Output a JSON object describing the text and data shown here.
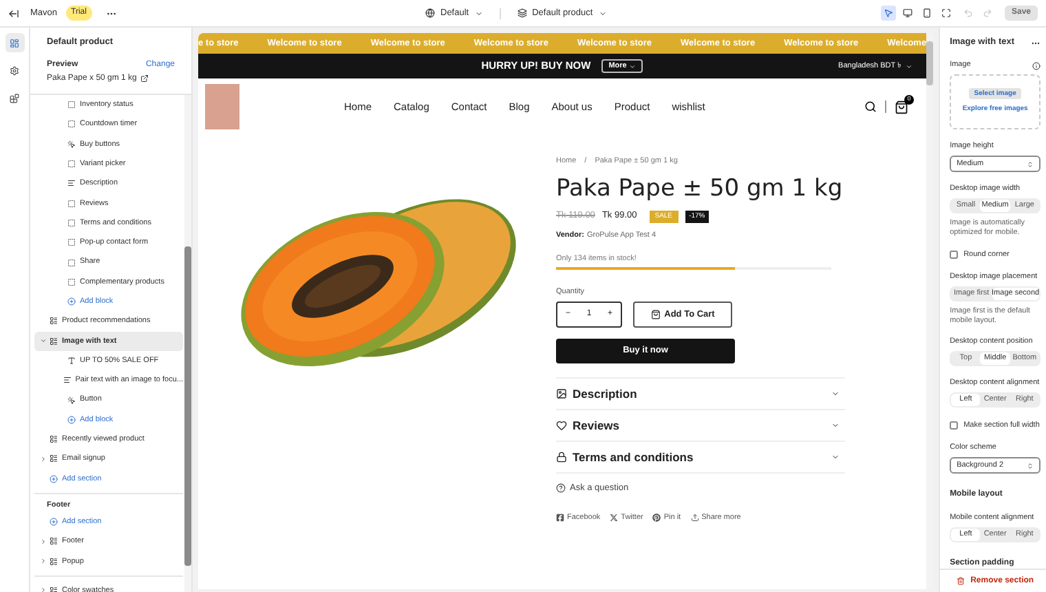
{
  "top_bar": {
    "store": "Mavon",
    "badge": "Trial",
    "theme_menu": "Default",
    "template_menu": "Default product",
    "save": {
      "label": "Save",
      "disabled": true
    },
    "tools": [
      {
        "kind": "inspect",
        "selected": true
      },
      {
        "kind": "desktop",
        "selected": false
      },
      {
        "kind": "mobile",
        "selected": false
      },
      {
        "kind": "fullscreen",
        "selected": false
      }
    ]
  },
  "rail": [
    {
      "kind": "sections",
      "selected": true
    },
    {
      "kind": "settings",
      "selected": false
    },
    {
      "kind": "apps",
      "selected": false
    }
  ],
  "left_panel": {
    "title": "Default product",
    "preview": {
      "label": "Preview",
      "action": "Change",
      "value": "Paka Pape x 50 gm 1 kg"
    },
    "groups": [
      {
        "items": [
          {
            "kind": "blocks",
            "children": [
              {
                "kind": "block",
                "label": "Inventory status",
                "selected": false
              },
              {
                "kind": "block",
                "label": "Countdown timer",
                "selected": false
              },
              {
                "kind": "button",
                "label": "Buy buttons",
                "selected": false
              },
              {
                "kind": "block",
                "label": "Variant picker",
                "selected": false
              },
              {
                "kind": "paragraph",
                "label": "Description",
                "selected": false
              },
              {
                "kind": "block",
                "label": "Reviews",
                "selected": false
              },
              {
                "kind": "block",
                "label": "Terms and conditions",
                "selected": false
              },
              {
                "kind": "block",
                "label": "Pop-up contact form",
                "selected": false
              },
              {
                "kind": "block",
                "label": "Share",
                "selected": false
              },
              {
                "kind": "block",
                "label": "Complementary products",
                "selected": false
              },
              {
                "kind": "add",
                "label": "Add block"
              }
            ]
          },
          {
            "kind": "section",
            "label": "Product recommendations",
            "selected": false
          },
          {
            "kind": "section",
            "label": "Image with text",
            "selected": true,
            "expanded": true,
            "children": [
              {
                "kind": "text",
                "label": "UP TO 50% SALE OFF",
                "selected": false
              },
              {
                "kind": "paragraph",
                "label": "Pair text with an image to focu...",
                "selected": false
              },
              {
                "kind": "button",
                "label": "Button",
                "selected": false
              },
              {
                "kind": "add",
                "label": "Add block"
              }
            ]
          },
          {
            "kind": "section",
            "label": "Recently viewed product",
            "selected": false
          },
          {
            "kind": "section",
            "label": "Email signup",
            "selected": false,
            "expanded": false
          },
          {
            "kind": "add",
            "label": "Add section"
          }
        ]
      },
      {
        "title": "Footer",
        "items": [
          {
            "kind": "add",
            "label": "Add section"
          },
          {
            "kind": "section",
            "label": "Footer",
            "selected": false,
            "expanded": false
          },
          {
            "kind": "section",
            "label": "Popup",
            "selected": false,
            "expanded": false
          }
        ]
      },
      {
        "items": [
          {
            "kind": "section",
            "label": "Color swatches",
            "selected": false,
            "expanded": false
          }
        ]
      }
    ]
  },
  "storefront": {
    "announcements": [
      "e to store",
      "Welcome to store",
      "Welcome to store",
      "Welcome to store",
      "Welcome to store",
      "Welcome to store",
      "Welcome to store",
      "Welcome"
    ],
    "promo": {
      "text": "HURRY UP! BUY NOW",
      "button": "More",
      "currency": "Bangladesh BDT ৳"
    },
    "nav": [
      "Home",
      "Catalog",
      "Contact",
      "Blog",
      "About us",
      "Product",
      "wishlist"
    ],
    "cart_count": "0",
    "product": {
      "breadcrumb": [
        "Home",
        "Paka Pape ± 50 gm 1 kg"
      ],
      "breadcrumb_separator": "/",
      "title": "Paka Pape ± 50 gm 1 kg",
      "compare_price": "Tk 119.00",
      "price": "Tk 99.00",
      "sale_badge": "SALE",
      "discount_badge": "-17%",
      "vendor_label": "Vendor:",
      "vendor": "GroPulse App Test 4",
      "stock": {
        "text": "Only 134 items in stock!",
        "level": 0.65
      },
      "quantity_label": "Quantity",
      "decrement": "−",
      "quantity": "1",
      "increment": "+",
      "add_to_cart": "Add To Cart",
      "buy_now": "Buy it now",
      "accordions": [
        {
          "kind": "description",
          "label": "Description",
          "expanded": false
        },
        {
          "kind": "reviews",
          "label": "Reviews",
          "expanded": false
        },
        {
          "kind": "terms",
          "label": "Terms and conditions",
          "expanded": false
        }
      ],
      "ask": "Ask a question",
      "share": [
        {
          "kind": "facebook",
          "label": "Facebook"
        },
        {
          "kind": "twitter",
          "label": "Twitter"
        },
        {
          "kind": "pinterest",
          "label": "Pin it"
        },
        {
          "kind": "share",
          "label": "Share more"
        }
      ]
    }
  },
  "settings": {
    "title": "Image with text",
    "fields": [
      {
        "kind": "image",
        "label": "Image",
        "button": "Select image",
        "link": "Explore free images"
      },
      {
        "kind": "select",
        "label": "Image height",
        "value": "Medium"
      },
      {
        "kind": "segmented",
        "label": "Desktop image width",
        "options": [
          {
            "label": "Small",
            "selected": false
          },
          {
            "label": "Medium",
            "selected": true
          },
          {
            "label": "Large",
            "selected": false
          }
        ],
        "hint": "Image is automatically optimized for mobile."
      },
      {
        "kind": "checkbox",
        "label": "Round corner",
        "checked": false
      },
      {
        "kind": "segmented",
        "label": "Desktop image placement",
        "options": [
          {
            "label": "Image first",
            "selected": false
          },
          {
            "label": "Image second",
            "selected": true
          }
        ],
        "hint": "Image first is the default mobile layout."
      },
      {
        "kind": "segmented",
        "label": "Desktop content position",
        "options": [
          {
            "label": "Top",
            "selected": false
          },
          {
            "label": "Middle",
            "selected": true
          },
          {
            "label": "Bottom",
            "selected": false
          }
        ]
      },
      {
        "kind": "segmented",
        "label": "Desktop content alignment",
        "options": [
          {
            "label": "Left",
            "selected": true
          },
          {
            "label": "Center",
            "selected": false
          },
          {
            "label": "Right",
            "selected": false
          }
        ]
      },
      {
        "kind": "checkbox",
        "label": "Make section full width",
        "checked": false
      },
      {
        "kind": "select",
        "label": "Color scheme",
        "value": "Background 2"
      },
      {
        "kind": "heading",
        "label": "Mobile layout"
      },
      {
        "kind": "segmented",
        "label": "Mobile content alignment",
        "options": [
          {
            "label": "Left",
            "selected": true
          },
          {
            "label": "Center",
            "selected": false
          },
          {
            "label": "Right",
            "selected": false
          }
        ]
      },
      {
        "kind": "heading",
        "label": "Section padding"
      }
    ],
    "remove": "Remove section"
  }
}
